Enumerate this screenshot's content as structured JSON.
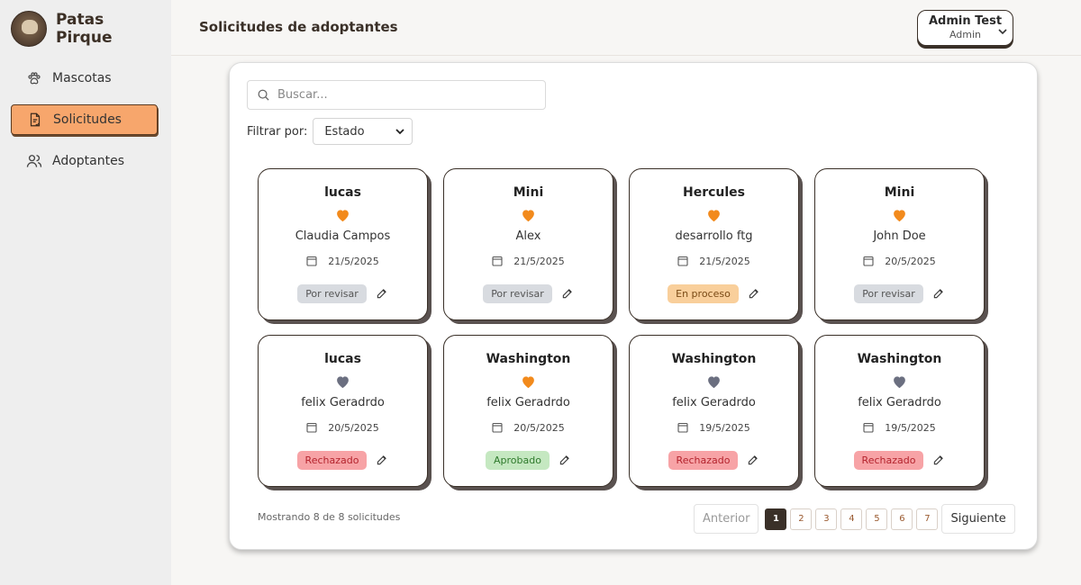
{
  "brand": {
    "name": "Patas Pirque"
  },
  "nav": [
    {
      "label": "Mascotas",
      "icon": "paw-icon",
      "active": false
    },
    {
      "label": "Solicitudes",
      "icon": "document-icon",
      "active": true
    },
    {
      "label": "Adoptantes",
      "icon": "users-icon",
      "active": false
    }
  ],
  "header": {
    "title": "Solicitudes de adoptantes",
    "user": {
      "name": "Admin Test",
      "role": "Admin"
    }
  },
  "search": {
    "placeholder": "Buscar..."
  },
  "filter": {
    "label": "Filtrar por:",
    "selected": "Estado"
  },
  "colors": {
    "accent": "#f7a66c",
    "heart_active": "#f28a1c",
    "heart_inactive": "#6b6f80",
    "dark": "#3a3028"
  },
  "requests": [
    {
      "pet": "lucas",
      "adopter": "Claudia Campos",
      "date": "21/5/2025",
      "status": "Por revisar",
      "status_type": "review",
      "heart": "orange"
    },
    {
      "pet": "Mini",
      "adopter": "Alex",
      "date": "21/5/2025",
      "status": "Por revisar",
      "status_type": "review",
      "heart": "orange"
    },
    {
      "pet": "Hercules",
      "adopter": "desarrollo ftg",
      "date": "21/5/2025",
      "status": "En proceso",
      "status_type": "process",
      "heart": "orange"
    },
    {
      "pet": "Mini",
      "adopter": "John Doe",
      "date": "20/5/2025",
      "status": "Por revisar",
      "status_type": "review",
      "heart": "orange"
    },
    {
      "pet": "lucas",
      "adopter": "felix Geradrdo",
      "date": "20/5/2025",
      "status": "Rechazado",
      "status_type": "rejected",
      "heart": "gray"
    },
    {
      "pet": "Washington",
      "adopter": "felix Geradrdo",
      "date": "20/5/2025",
      "status": "Aprobado",
      "status_type": "approved",
      "heart": "orange"
    },
    {
      "pet": "Washington",
      "adopter": "felix Geradrdo",
      "date": "19/5/2025",
      "status": "Rechazado",
      "status_type": "rejected",
      "heart": "gray"
    },
    {
      "pet": "Washington",
      "adopter": "felix Geradrdo",
      "date": "19/5/2025",
      "status": "Rechazado",
      "status_type": "rejected",
      "heart": "gray"
    }
  ],
  "footer": {
    "showing": "Mostrando 8 de 8 solicitudes"
  },
  "pagination": {
    "prev": "Anterior",
    "next": "Siguiente",
    "pages": [
      "1",
      "2",
      "3",
      "4",
      "5",
      "6",
      "7"
    ],
    "current": "1"
  }
}
